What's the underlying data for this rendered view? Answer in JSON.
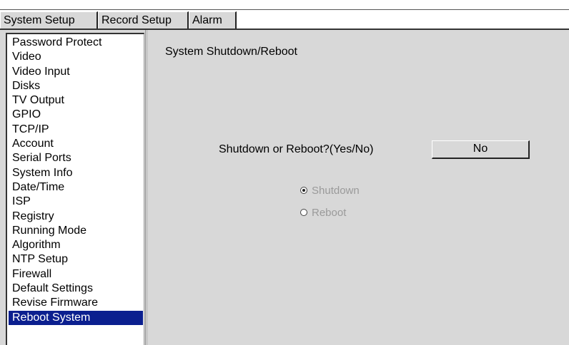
{
  "tabs": [
    {
      "label": "System Setup",
      "active": true
    },
    {
      "label": "Record Setup",
      "active": false
    },
    {
      "label": "Alarm",
      "active": false
    }
  ],
  "sidebar": {
    "items": [
      {
        "label": "Password Protect"
      },
      {
        "label": "Video"
      },
      {
        "label": "Video Input"
      },
      {
        "label": "Disks"
      },
      {
        "label": "TV Output"
      },
      {
        "label": "GPIO"
      },
      {
        "label": "TCP/IP"
      },
      {
        "label": "Account"
      },
      {
        "label": "Serial Ports"
      },
      {
        "label": "System Info"
      },
      {
        "label": "Date/Time"
      },
      {
        "label": "ISP"
      },
      {
        "label": "Registry"
      },
      {
        "label": "Running Mode"
      },
      {
        "label": "Algorithm"
      },
      {
        "label": "NTP Setup"
      },
      {
        "label": "Firewall"
      },
      {
        "label": "Default Settings"
      },
      {
        "label": "Revise Firmware"
      },
      {
        "label": "Reboot System",
        "selected": true
      }
    ]
  },
  "panel": {
    "title": "System Shutdown/Reboot",
    "prompt": "Shutdown or Reboot?(Yes/No)",
    "confirm_value": "No",
    "options": [
      {
        "label": "Shutdown",
        "checked": true
      },
      {
        "label": "Reboot",
        "checked": false
      }
    ]
  },
  "colors": {
    "selection": "#0b1f8f",
    "background": "#d8d8d8",
    "disabled_text": "#9a9a9a"
  }
}
